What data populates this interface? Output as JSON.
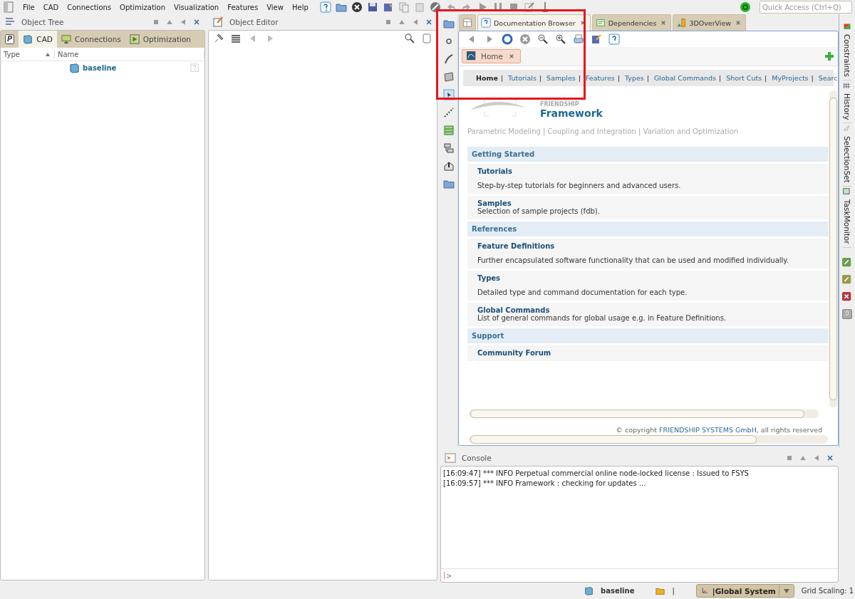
{
  "menu": [
    "File",
    "CAD",
    "Connections",
    "Optimization",
    "Visualization",
    "Features",
    "View",
    "Help"
  ],
  "quick_access": {
    "placeholder": "Quick Access (Ctrl+Q)"
  },
  "object_tree": {
    "title": "Object Tree",
    "tabs": [
      {
        "kind": "letter",
        "label": "P",
        "selected": false
      },
      {
        "kind": "text",
        "label": "CAD",
        "selected": true
      },
      {
        "kind": "text",
        "label": "Connections",
        "selected": false
      },
      {
        "kind": "text",
        "label": "Optimization",
        "selected": false
      }
    ],
    "columns": [
      {
        "label": "Type",
        "sorted": true
      },
      {
        "label": "Name",
        "sorted": false
      }
    ],
    "rows": [
      {
        "name": "baseline"
      }
    ]
  },
  "object_editor": {
    "title": "Object Editor"
  },
  "editor_tabs": [
    {
      "kind": "icon",
      "selected": false
    },
    {
      "kind": "text",
      "label": "Documentation Browser",
      "selected": true
    },
    {
      "kind": "text",
      "label": "Dependencies",
      "selected": false
    },
    {
      "kind": "text",
      "label": "3DOverView",
      "selected": false
    }
  ],
  "browser": {
    "page_tab": {
      "label": "Home",
      "selected": true
    },
    "nav": [
      {
        "label": "Home",
        "selected": true,
        "separator": "|"
      },
      {
        "label": "Tutorials",
        "selected": false,
        "separator": "|"
      },
      {
        "label": "Samples",
        "selected": false,
        "separator": "|"
      },
      {
        "label": "Features",
        "selected": false,
        "separator": "|"
      },
      {
        "label": "Types",
        "selected": false,
        "separator": "|"
      },
      {
        "label": "Global Commands",
        "selected": false,
        "separator": "|"
      },
      {
        "label": "Short Cuts",
        "selected": false,
        "separator": "|"
      },
      {
        "label": "MyProjects",
        "selected": false,
        "separator": "|"
      },
      {
        "label": "Searc",
        "selected": false
      }
    ],
    "logo": {
      "small": "FRIENDSHIP",
      "name": "Framework"
    },
    "tagline": "Parametric Modeling | Coupling and Integration | Variation and Optimization",
    "sections": [
      {
        "heading": "Getting Started",
        "items": [
          {
            "title": "Tutorials",
            "description": "Step-by-step tutorials for beginners and advanced users."
          },
          {
            "title": "Samples",
            "description": "Selection of sample projects (fdb)."
          }
        ]
      },
      {
        "heading": "References",
        "items": [
          {
            "title": "Feature Definitions",
            "description": "Further encapsulated software functionality that can be used and modified individually."
          },
          {
            "title": "Types",
            "description": "Detailed type and command documentation for each type."
          },
          {
            "title": "Global Commands",
            "description": "List of general commands for global usage e.g. in Feature Definitions."
          }
        ]
      },
      {
        "heading": "Support",
        "items": [
          {
            "title": "Community Forum"
          }
        ]
      }
    ],
    "copyright": {
      "before": "© copyright ",
      "link": "FRIENDSHIP SYSTEMS GmbH",
      "after": ", all rights reserved"
    }
  },
  "side_tabs": [
    "Constraints",
    "History",
    "SelectionSet",
    "TaskMonitor"
  ],
  "side_counter": "0",
  "console": {
    "title": "Console",
    "lines": [
      "[16:09:47] *** INFO Perpetual commercial online node-locked license : Issued to FSYS",
      "[16:09:57] *** INFO Framework : checking for updates ..."
    ],
    "prompt": ">"
  },
  "status_bar": {
    "object": "baseline",
    "separator": "|",
    "system": "|Global System",
    "grid_scaling": "Grid Scaling: 1"
  }
}
